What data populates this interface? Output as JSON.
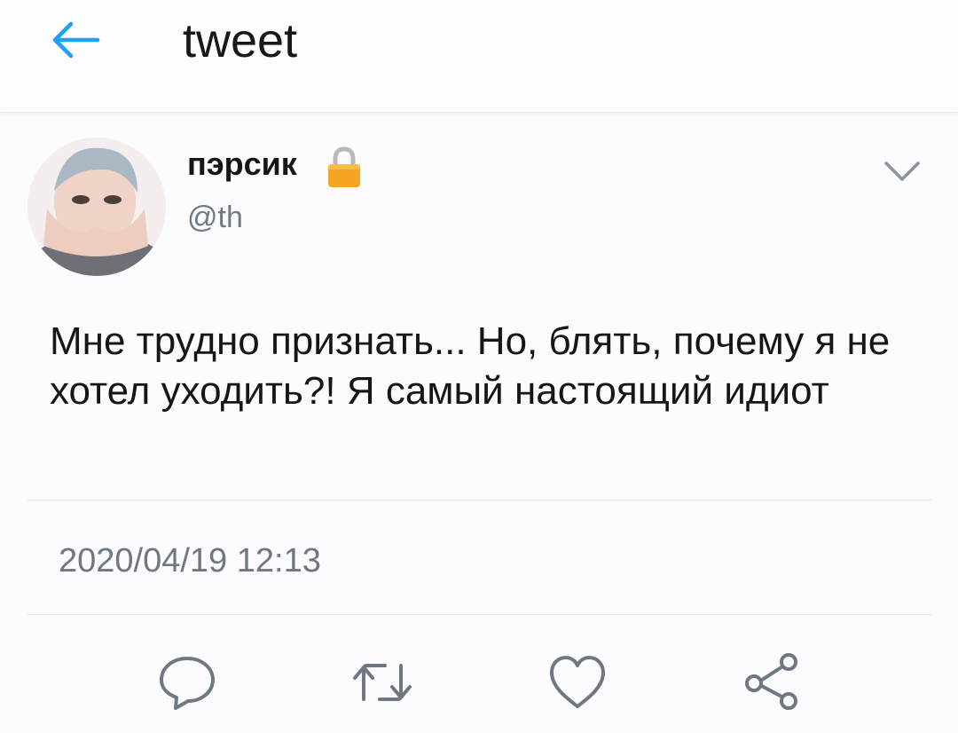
{
  "header": {
    "title": "tweet",
    "back_icon": "back-arrow-icon",
    "accent_color": "#1da1f2"
  },
  "tweet": {
    "author": {
      "display_name": "пэрсик",
      "handle": "@th",
      "protected_icon": "lock-icon"
    },
    "text": "Мне трудно признать... Но, блять, почему я не хотел уходить?! Я самый настоящий идиот",
    "timestamp": "2020/04/19 12:13",
    "menu_icon": "chevron-down-icon"
  },
  "actions": {
    "reply_icon": "reply-icon",
    "retweet_icon": "retweet-icon",
    "like_icon": "heart-icon",
    "share_icon": "share-icon",
    "icon_color": "#6f7782"
  }
}
